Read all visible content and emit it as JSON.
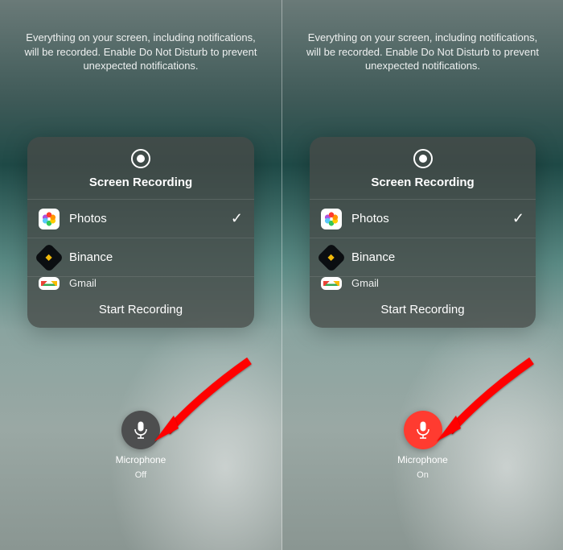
{
  "notice": "Everything on your screen, including notifications, will be recorded. Enable Do Not Disturb to prevent unexpected notifications.",
  "card": {
    "title": "Screen Recording",
    "apps": [
      {
        "name": "Photos",
        "selected": true
      },
      {
        "name": "Binance",
        "selected": false
      },
      {
        "name": "Gmail",
        "selected": false
      }
    ],
    "action": "Start Recording"
  },
  "mic": {
    "label": "Microphone",
    "left_status": "Off",
    "right_status": "On"
  }
}
